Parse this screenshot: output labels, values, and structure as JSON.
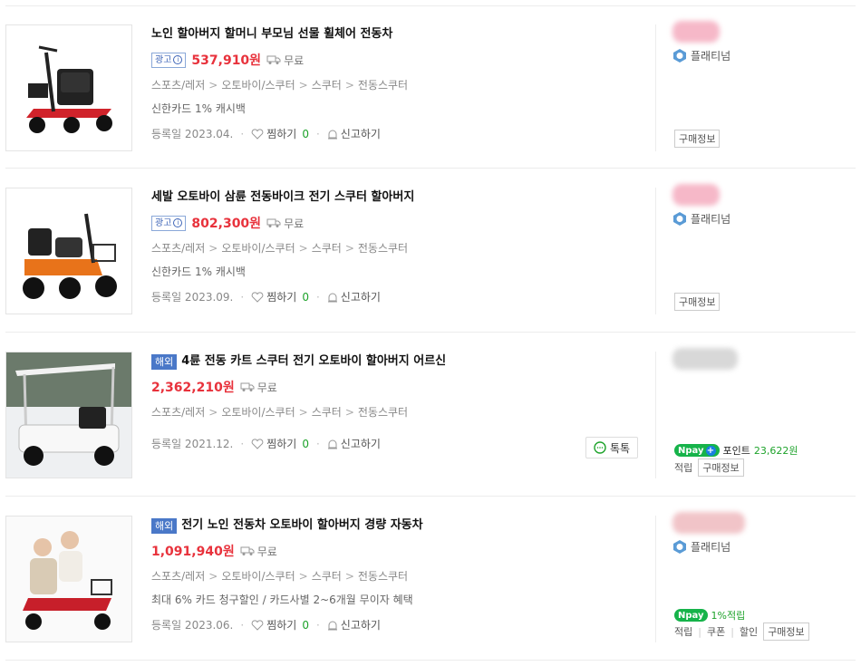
{
  "common": {
    "ship_label": "무료",
    "report_label": "신고하기",
    "zzim_label": "찜하기",
    "buyinfo_label": "구매정보",
    "grade_label": "플래티넘",
    "ad_label": "광고",
    "overseas_label": "해외",
    "cat_sep": ">",
    "dot": "·"
  },
  "products": [
    {
      "title": "노인 할아버지 할머니 부모님 선물 휠체어 전동차",
      "price": "537,910원",
      "categories": [
        "스포츠/레저",
        "오토바이/스쿠터",
        "스쿠터",
        "전동스쿠터"
      ],
      "benefit": "신한카드 1% 캐시백",
      "reg_date": "등록일 2023.04.",
      "zzim_count": "0",
      "seller_color": "#f6b8c8"
    },
    {
      "title": "세발 오토바이 삼륜 전동바이크 전기 스쿠터 할아버지",
      "price": "802,300원",
      "categories": [
        "스포츠/레저",
        "오토바이/스쿠터",
        "스쿠터",
        "전동스쿠터"
      ],
      "benefit": "신한카드 1% 캐시백",
      "reg_date": "등록일 2023.09.",
      "zzim_count": "0",
      "seller_color": "#f6b8c8"
    },
    {
      "title": "4륜 전동 카트 스쿠터 전기 오토바이 할아버지 어르신",
      "price": "2,362,210원",
      "categories": [
        "스포츠/레저",
        "오토바이/스쿠터",
        "스쿠터",
        "전동스쿠터"
      ],
      "reg_date": "등록일 2021.12.",
      "zzim_count": "0",
      "talk_label": "톡톡",
      "npay_label": "pay",
      "point_label": "포인트",
      "point_value": "23,622원",
      "earn_label": "적립",
      "seller_color": "#d8d8d8"
    },
    {
      "title": "전기 노인 전동차 오토바이 할아버지 경량 자동차",
      "price": "1,091,940원",
      "categories": [
        "스포츠/레저",
        "오토바이/스쿠터",
        "스쿠터",
        "전동스쿠터"
      ],
      "benefit": "최대 6% 카드 청구할인 / 카드사별 2~6개월 무이자 혜택",
      "reg_date": "등록일 2023.06.",
      "zzim_count": "0",
      "npay_label": "pay",
      "npay_earn": "1%적립",
      "links": [
        "적립",
        "쿠폰",
        "할인"
      ],
      "seller_color": "#f1c4c8"
    }
  ],
  "colors": {
    "price": "#e8323c",
    "accent_green": "#1ea32b",
    "overseas": "#4a78c8"
  }
}
